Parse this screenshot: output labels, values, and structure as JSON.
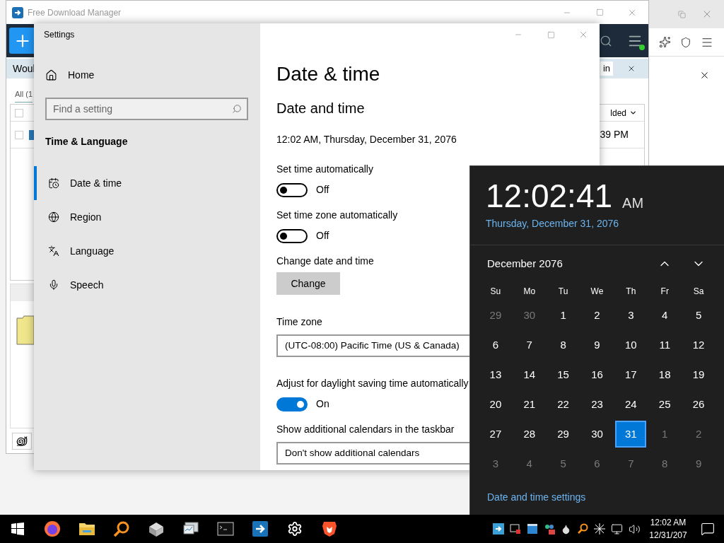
{
  "fdm": {
    "title": "Free Download Manager",
    "banner_text": "Woul",
    "banner_button": "in",
    "filter_tab": "All (1",
    "table": {
      "header": {
        "checked": false,
        "label": "lded"
      },
      "rows": [
        {
          "checked": false,
          "cell": "39 PM"
        }
      ]
    }
  },
  "settings": {
    "title": "Settings",
    "home": "Home",
    "search": {
      "placeholder": "Find a setting"
    },
    "section": "Time & Language",
    "nav": [
      {
        "label": "Date & time",
        "kind": "clock",
        "selected": true
      },
      {
        "label": "Region",
        "kind": "globe",
        "selected": false
      },
      {
        "label": "Language",
        "kind": "language",
        "selected": false
      },
      {
        "label": "Speech",
        "kind": "mic",
        "selected": false
      }
    ],
    "page_title": "Date & time",
    "group_title": "Date and time",
    "current_time": "12:02 AM, Thursday, December 31, 2076",
    "items": [
      {
        "kind": "toggle",
        "label": "Set time automatically",
        "on": false,
        "state_text": "Off"
      },
      {
        "kind": "toggle",
        "label": "Set time zone automatically",
        "on": false,
        "state_text": "Off"
      },
      {
        "kind": "button",
        "label": "Change date and time",
        "button": "Change"
      },
      {
        "kind": "select",
        "label": "Time zone",
        "value": "(UTC-08:00) Pacific Time (US & Canada)"
      },
      {
        "kind": "toggle",
        "label": "Adjust for daylight saving time automatically",
        "on": true,
        "state_text": "On"
      },
      {
        "kind": "select",
        "label": "Show additional calendars in the taskbar",
        "value": "Don't show additional calendars"
      }
    ]
  },
  "clock_flyout": {
    "time": "12:02:41",
    "ampm": "AM",
    "date": "Thursday, December 31, 2076",
    "month": "December 2076",
    "weekdays": [
      "Su",
      "Mo",
      "Tu",
      "We",
      "Th",
      "Fr",
      "Sa"
    ],
    "weeks": [
      [
        {
          "day": "29",
          "in_month": false,
          "selected": false
        },
        {
          "day": "30",
          "in_month": false,
          "selected": false
        },
        {
          "day": "1",
          "in_month": true,
          "selected": false
        },
        {
          "day": "2",
          "in_month": true,
          "selected": false
        },
        {
          "day": "3",
          "in_month": true,
          "selected": false
        },
        {
          "day": "4",
          "in_month": true,
          "selected": false
        },
        {
          "day": "5",
          "in_month": true,
          "selected": false
        }
      ],
      [
        {
          "day": "6",
          "in_month": true,
          "selected": false
        },
        {
          "day": "7",
          "in_month": true,
          "selected": false
        },
        {
          "day": "8",
          "in_month": true,
          "selected": false
        },
        {
          "day": "9",
          "in_month": true,
          "selected": false
        },
        {
          "day": "10",
          "in_month": true,
          "selected": false
        },
        {
          "day": "11",
          "in_month": true,
          "selected": false
        },
        {
          "day": "12",
          "in_month": true,
          "selected": false
        }
      ],
      [
        {
          "day": "13",
          "in_month": true,
          "selected": false
        },
        {
          "day": "14",
          "in_month": true,
          "selected": false
        },
        {
          "day": "15",
          "in_month": true,
          "selected": false
        },
        {
          "day": "16",
          "in_month": true,
          "selected": false
        },
        {
          "day": "17",
          "in_month": true,
          "selected": false
        },
        {
          "day": "18",
          "in_month": true,
          "selected": false
        },
        {
          "day": "19",
          "in_month": true,
          "selected": false
        }
      ],
      [
        {
          "day": "20",
          "in_month": true,
          "selected": false
        },
        {
          "day": "21",
          "in_month": true,
          "selected": false
        },
        {
          "day": "22",
          "in_month": true,
          "selected": false
        },
        {
          "day": "23",
          "in_month": true,
          "selected": false
        },
        {
          "day": "24",
          "in_month": true,
          "selected": false
        },
        {
          "day": "25",
          "in_month": true,
          "selected": false
        },
        {
          "day": "26",
          "in_month": true,
          "selected": false
        }
      ],
      [
        {
          "day": "27",
          "in_month": true,
          "selected": false
        },
        {
          "day": "28",
          "in_month": true,
          "selected": false
        },
        {
          "day": "29",
          "in_month": true,
          "selected": false
        },
        {
          "day": "30",
          "in_month": true,
          "selected": false
        },
        {
          "day": "31",
          "in_month": true,
          "selected": true
        },
        {
          "day": "1",
          "in_month": false,
          "selected": false
        },
        {
          "day": "2",
          "in_month": false,
          "selected": false
        }
      ],
      [
        {
          "day": "3",
          "in_month": false,
          "selected": false
        },
        {
          "day": "4",
          "in_month": false,
          "selected": false
        },
        {
          "day": "5",
          "in_month": false,
          "selected": false
        },
        {
          "day": "6",
          "in_month": false,
          "selected": false
        },
        {
          "day": "7",
          "in_month": false,
          "selected": false
        },
        {
          "day": "8",
          "in_month": false,
          "selected": false
        },
        {
          "day": "9",
          "in_month": false,
          "selected": false
        }
      ]
    ],
    "settings_link": "Date and time settings"
  },
  "taskbar": {
    "time": "12:02 AM",
    "date": "12/31/207"
  }
}
